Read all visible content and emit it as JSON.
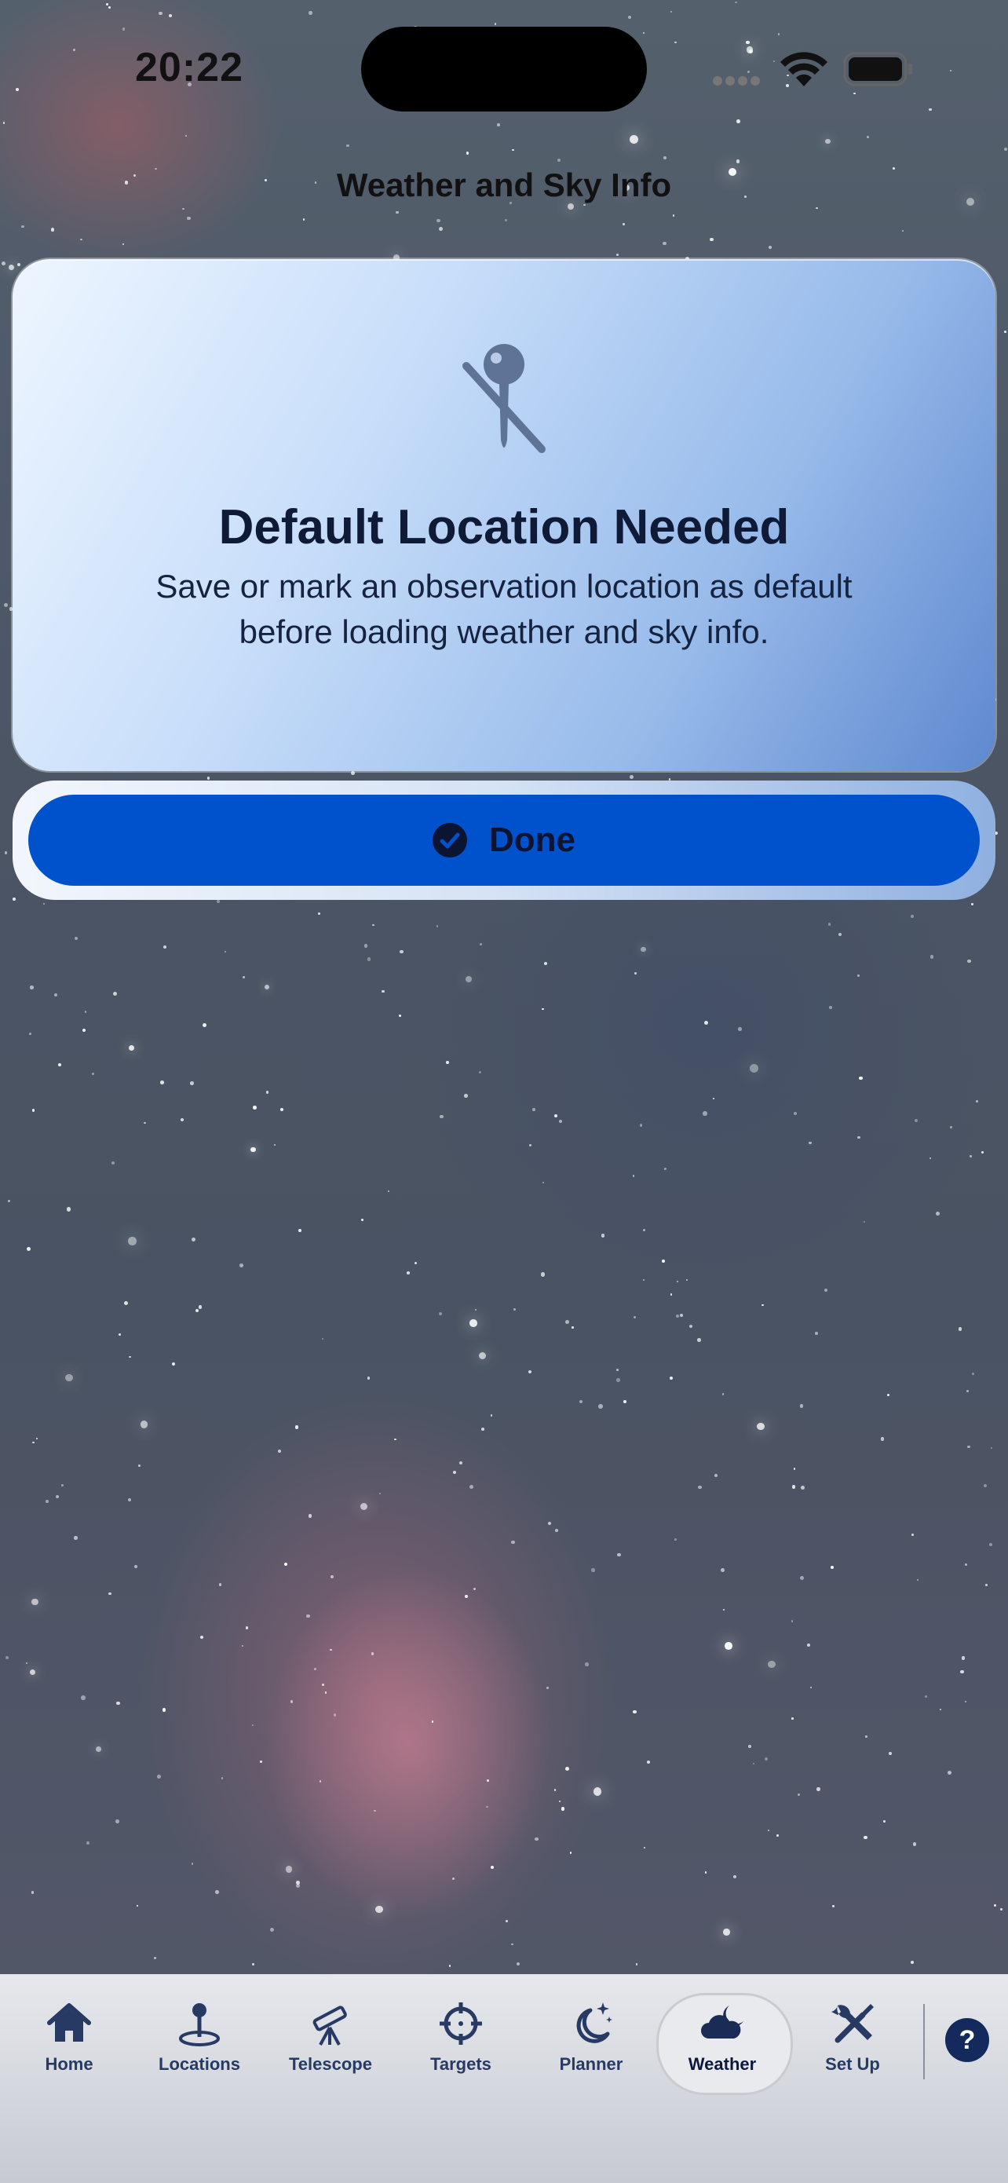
{
  "status_bar": {
    "time": "20:22"
  },
  "page_title": "Weather and Sky Info",
  "alert": {
    "icon": "location-pin-slash-icon",
    "title": "Default Location Needed",
    "message": "Save or mark an observation location as default before loading weather and sky info."
  },
  "done_button": {
    "label": "Done",
    "icon": "checkmark-circle-icon"
  },
  "tabs": [
    {
      "label": "Home",
      "icon": "house-icon"
    },
    {
      "label": "Locations",
      "icon": "map-pin-icon"
    },
    {
      "label": "Telescope",
      "icon": "telescope-icon"
    },
    {
      "label": "Targets",
      "icon": "crosshair-icon"
    },
    {
      "label": "Planner",
      "icon": "moon-stars-icon"
    },
    {
      "label": "Weather",
      "icon": "cloud-moon-icon",
      "active": true
    },
    {
      "label": "Set Up",
      "icon": "wrench-screwdriver-icon"
    }
  ],
  "help_button": {
    "label": "?"
  },
  "colors": {
    "accent": "#0052cc",
    "tab_text": "#273a63",
    "title_text": "#0e1a36"
  }
}
